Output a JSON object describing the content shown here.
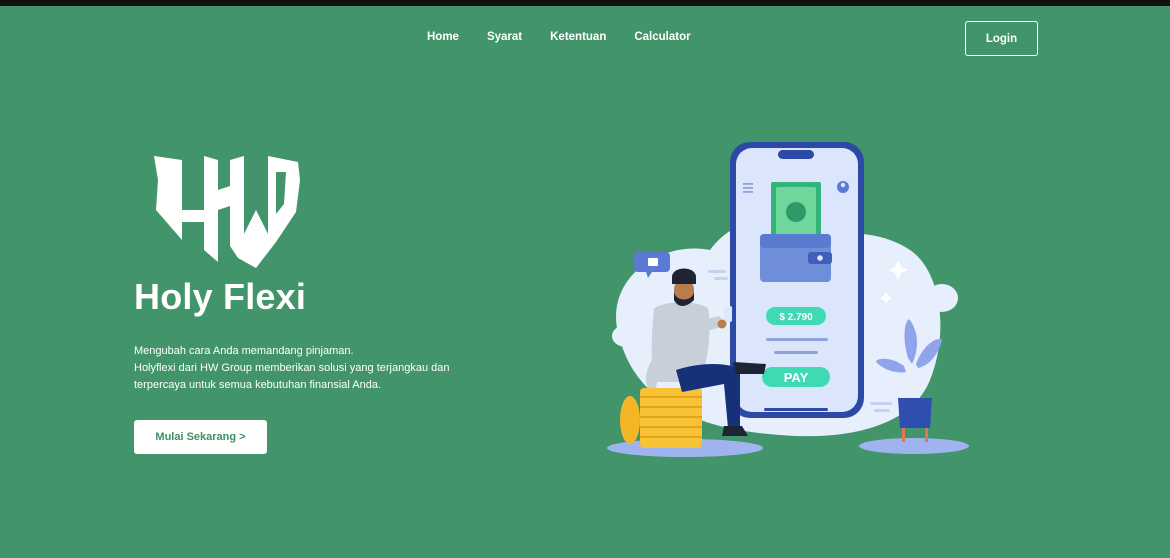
{
  "nav": {
    "links": [
      "Home",
      "Syarat",
      "Ketentuan",
      "Calculator"
    ],
    "login_label": "Login"
  },
  "logo": {
    "monogram": "HW"
  },
  "hero": {
    "brand": "Holy Flexi",
    "tagline_1": "Mengubah cara Anda memandang pinjaman.",
    "tagline_2": "Holyflexi dari HW Group memberikan solusi yang terjangkau dan terpercaya untuk semua kebutuhan finansial Anda.",
    "cta_label": "Mulai Sekarang >"
  },
  "illustration": {
    "amount": "$ 2.790",
    "pay_label": "PAY"
  },
  "colors": {
    "background": "#42956a",
    "button_text": "#3f8f65",
    "phone_frame": "#2c49a8",
    "accent_teal": "#3fd9b4"
  }
}
